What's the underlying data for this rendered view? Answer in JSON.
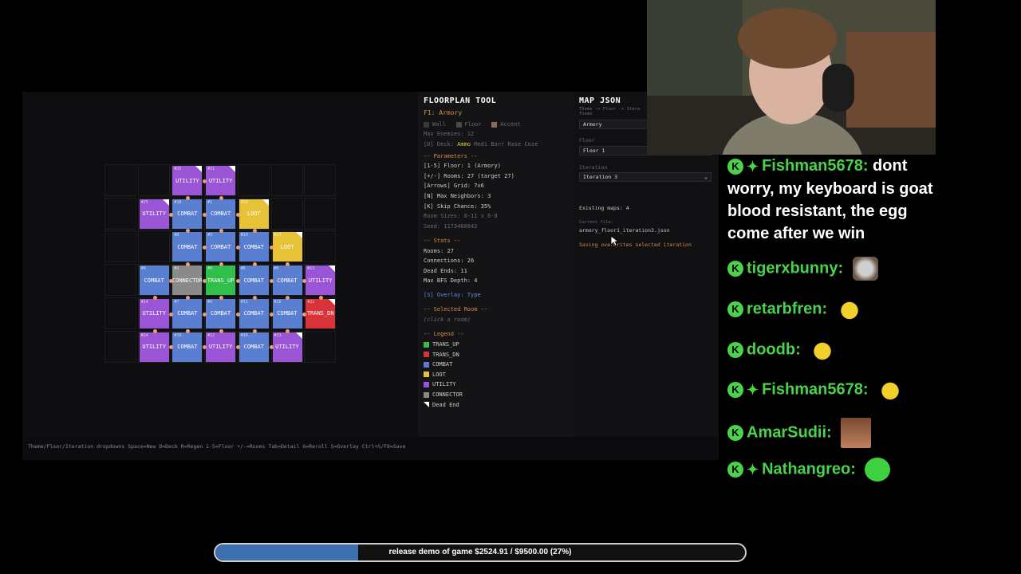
{
  "panel": {
    "title": "FLOORPLAN TOOL",
    "subtitle": "F1: Armory",
    "toggles": [
      "Wall",
      "Floor",
      "Accent"
    ],
    "max_enemies": "Max Enemies: 12",
    "deck_label": "[D] Deck:",
    "deck_selected": "Ammo",
    "deck_others": "Medi Barr Rase Coze",
    "params_header": "-- Parameters --",
    "params": [
      "[1-5] Floor: 1 (Armory)",
      "[+/-] Rooms: 27 (target 27)",
      "[Arrows] Grid: 7x6",
      "[N] Max Neighbors: 3",
      "[K] Skip Chance: 35%",
      "Room Sizes: 8-11 x 6-8",
      "Seed: 1173460842"
    ],
    "stats_header": "-- Stats --",
    "stats": [
      "Rooms: 27",
      "Connections: 26",
      "Dead Ends: 11",
      "Max BFS Depth: 4"
    ],
    "overlay": "[S] Overlay: Type",
    "selected_header": "-- Selected Room --",
    "selected_hint": "(click a room)",
    "legend_header": "-- Legend --",
    "legend": [
      {
        "label": "TRANS_UP",
        "color": "#2fbf4a"
      },
      {
        "label": "TRANS_DN",
        "color": "#d8323a"
      },
      {
        "label": "COMBAT",
        "color": "#5b7fd0"
      },
      {
        "label": "LOOT",
        "color": "#e7c236"
      },
      {
        "label": "UTILITY",
        "color": "#9a55d6"
      },
      {
        "label": "CONNECTOR",
        "color": "#8a8a8a"
      },
      {
        "label": "Dead End",
        "color": "#ffffff"
      }
    ]
  },
  "json_panel": {
    "title": "MAP JSON",
    "breadcrumb": "Theme -> Floor -> Itera",
    "theme_label": "Theme",
    "theme_value": "Armory",
    "floor_label": "Floor",
    "floor_value": "Floor 1",
    "iteration_label": "Iteration",
    "iteration_value": "Iteration 3",
    "existing": "Existing maps: 4",
    "current_label": "Current file:",
    "current_file": "armory_floor1_iteration3.json",
    "save_note": "Saving overwrites selected iteration"
  },
  "footer": {
    "hints": "Theme/Floor/Iteration dropdowns  Space=New  D=Deck  R=Regen  1-5=Floor  +/-=Rooms  Tab=Detail  G=Reroll  S=Overlay  Ctrl+S/F8=Save"
  },
  "rooms": [
    {
      "num": "#25",
      "label": "UTILITY",
      "type": "utility",
      "dead": true
    },
    {
      "num": "#21",
      "label": "UTILITY",
      "type": "utility",
      "dead": true
    },
    {
      "num": "#25",
      "label": "UTILITY",
      "type": "utility",
      "dead": true
    },
    {
      "num": "#18",
      "label": "COMBAT",
      "type": "combat",
      "dead": false
    },
    {
      "num": "#1",
      "label": "COMBAT",
      "type": "combat",
      "dead": false
    },
    {
      "num": "#20",
      "label": "LOOT",
      "type": "loot",
      "dead": true
    },
    {
      "num": "#8",
      "label": "COMBAT",
      "type": "combat",
      "dead": false
    },
    {
      "num": "#3",
      "label": "COMBAT",
      "type": "combat",
      "dead": false
    },
    {
      "num": "#10",
      "label": "COMBAT",
      "type": "combat",
      "dead": false
    },
    {
      "num": "#17",
      "label": "LOOT",
      "type": "loot",
      "dead": true
    },
    {
      "num": "#9",
      "label": "COMBAT",
      "type": "combat",
      "dead": false
    },
    {
      "num": "#2",
      "label": "CONNECTOR",
      "type": "connector",
      "dead": false
    },
    {
      "num": "#0",
      "label": "TRANS_UP",
      "type": "transup",
      "dead": false
    },
    {
      "num": "#6",
      "label": "COMBAT",
      "type": "combat",
      "dead": false
    },
    {
      "num": "#5",
      "label": "COMBAT",
      "type": "combat",
      "dead": false
    },
    {
      "num": "#13",
      "label": "UTILITY",
      "type": "utility",
      "dead": true
    },
    {
      "num": "#14",
      "label": "UTILITY",
      "type": "utility",
      "dead": false
    },
    {
      "num": "#7",
      "label": "COMBAT",
      "type": "combat",
      "dead": false
    },
    {
      "num": "#4",
      "label": "COMBAT",
      "type": "combat",
      "dead": false
    },
    {
      "num": "#11",
      "label": "COMBAT",
      "type": "combat",
      "dead": false
    },
    {
      "num": "#15",
      "label": "COMBAT",
      "type": "combat",
      "dead": false
    },
    {
      "num": "#22",
      "label": "TRANS_DN",
      "type": "transdn",
      "dead": true
    },
    {
      "num": "#24",
      "label": "UTILITY",
      "type": "utility",
      "dead": false
    },
    {
      "num": "#19",
      "label": "COMBAT",
      "type": "combat",
      "dead": false
    },
    {
      "num": "#12",
      "label": "UTILITY",
      "type": "utility",
      "dead": false
    },
    {
      "num": "#16",
      "label": "COMBAT",
      "type": "combat",
      "dead": false
    },
    {
      "num": "#23",
      "label": "UTILITY",
      "type": "utility",
      "dead": true
    }
  ],
  "chat": [
    {
      "user": "Fishman5678:",
      "text": "dont worry, my keyboard is goat blood resistant, the egg come after we win",
      "emote": ""
    },
    {
      "user": "tigerxbunny:",
      "text": "",
      "emote": "goat"
    },
    {
      "user": "retarbfren:",
      "text": "",
      "emote": "bee"
    },
    {
      "user": "doodb:",
      "text": "",
      "emote": "bee"
    },
    {
      "user": "Fishman5678:",
      "text": "",
      "emote": "bee"
    },
    {
      "user": "AmarSudii:",
      "text": "",
      "emote": "man"
    },
    {
      "user": "Nathangreo:",
      "text": "",
      "emote": "frog"
    }
  ],
  "progress": {
    "label": "release demo of game $2524.91 / $9500.00 (27%)",
    "fraction": 0.27
  },
  "colors": {
    "combat": "#5b7fd0",
    "utility": "#9a55d6",
    "loot": "#e7c236",
    "transup": "#2fbf4a",
    "transdn": "#d8323a",
    "connector": "#8a8a8a"
  }
}
